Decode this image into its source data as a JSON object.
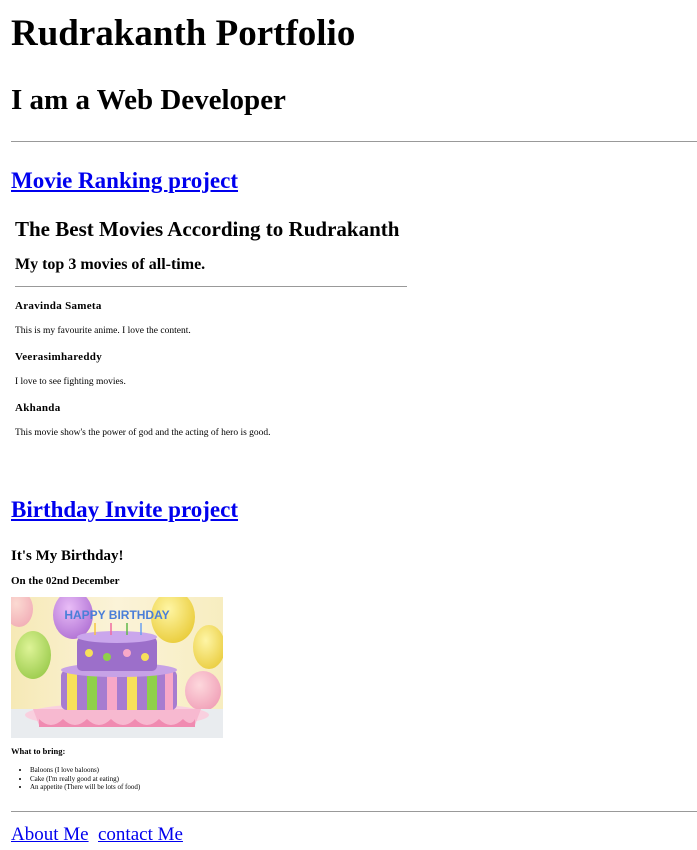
{
  "header": {
    "title": "Rudrakanth Portfolio",
    "subtitle": "I am a Web Developer"
  },
  "projects": {
    "movie_link": "Movie Ranking project",
    "birthday_link": "Birthday Invite project"
  },
  "movies": {
    "title": "The Best Movies According to Rudrakanth",
    "subtitle": "My top 3 movies of all-time.",
    "items": [
      {
        "name": "Aravinda Sameta",
        "desc": "This is my favourite anime. I love the content."
      },
      {
        "name": "Veerasimhareddy",
        "desc": "I love to see fighting movies."
      },
      {
        "name": "Akhanda",
        "desc": "This movie show's the power of god and the acting of hero is good."
      }
    ]
  },
  "birthday": {
    "title": "It's My Birthday!",
    "date": "On the 02nd December",
    "cake_text": "HAPPY BIRTHDAY",
    "bring_label": "What to bring:",
    "bring_items": [
      "Baloons (I love baloons)",
      "Cake (I'm really good at eating)",
      "An appetite (There will be lots of food)"
    ]
  },
  "footer": {
    "about": "About Me",
    "contact": "contact Me"
  }
}
